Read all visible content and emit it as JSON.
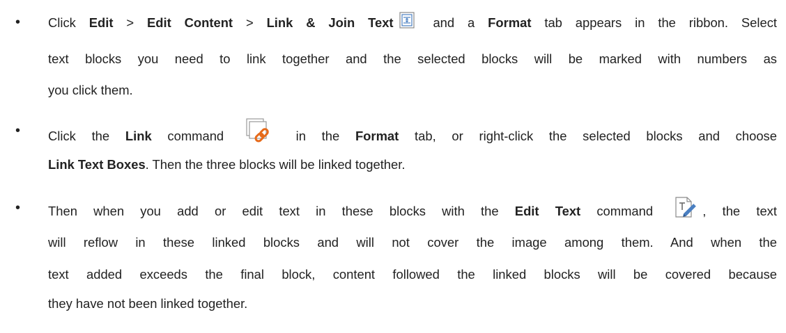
{
  "icons": {
    "link_join_text": "link-join-text-icon",
    "link": "link-icon",
    "edit_text": "edit-text-icon"
  },
  "colors": {
    "text": "#222222",
    "icon_blue": "#4a7fc1",
    "icon_orange": "#e66a1a",
    "icon_gray": "#8a8a8a"
  },
  "bullets": [
    {
      "b1_t1": "Click ",
      "b1_edit": "Edit",
      "b1_t2": " > ",
      "b1_edit_content": "Edit Content",
      "b1_t3": " > ",
      "b1_link_join": "Link & Join Text",
      "b1_t4": " and a ",
      "b1_format": "Format",
      "b1_t5": " tab appears in the ribbon. Select",
      "b1_l2": "text blocks you need to link together and the selected blocks will be marked with numbers as",
      "b1_l3": "you click them."
    },
    {
      "b2_t1": "Click the ",
      "b2_link": "Link",
      "b2_t2": " command ",
      "b2_t3": " in the ",
      "b2_format": "Format",
      "b2_t4": " tab, or right-click the selected blocks and choose",
      "b2_link_boxes": "Link Text Boxes",
      "b2_t5": ". Then the three blocks will be linked together."
    },
    {
      "b3_t1": "Then when you add or edit text in these blocks with the ",
      "b3_edit_text": "Edit Text",
      "b3_t2": " command ",
      "b3_t3": ", the text",
      "b3_l2": "will reflow in these linked blocks and will not cover the image among them. And when the",
      "b3_l3": "text added exceeds the final block, content followed the linked blocks will be covered because",
      "b3_l4": "they have not been linked together."
    }
  ]
}
